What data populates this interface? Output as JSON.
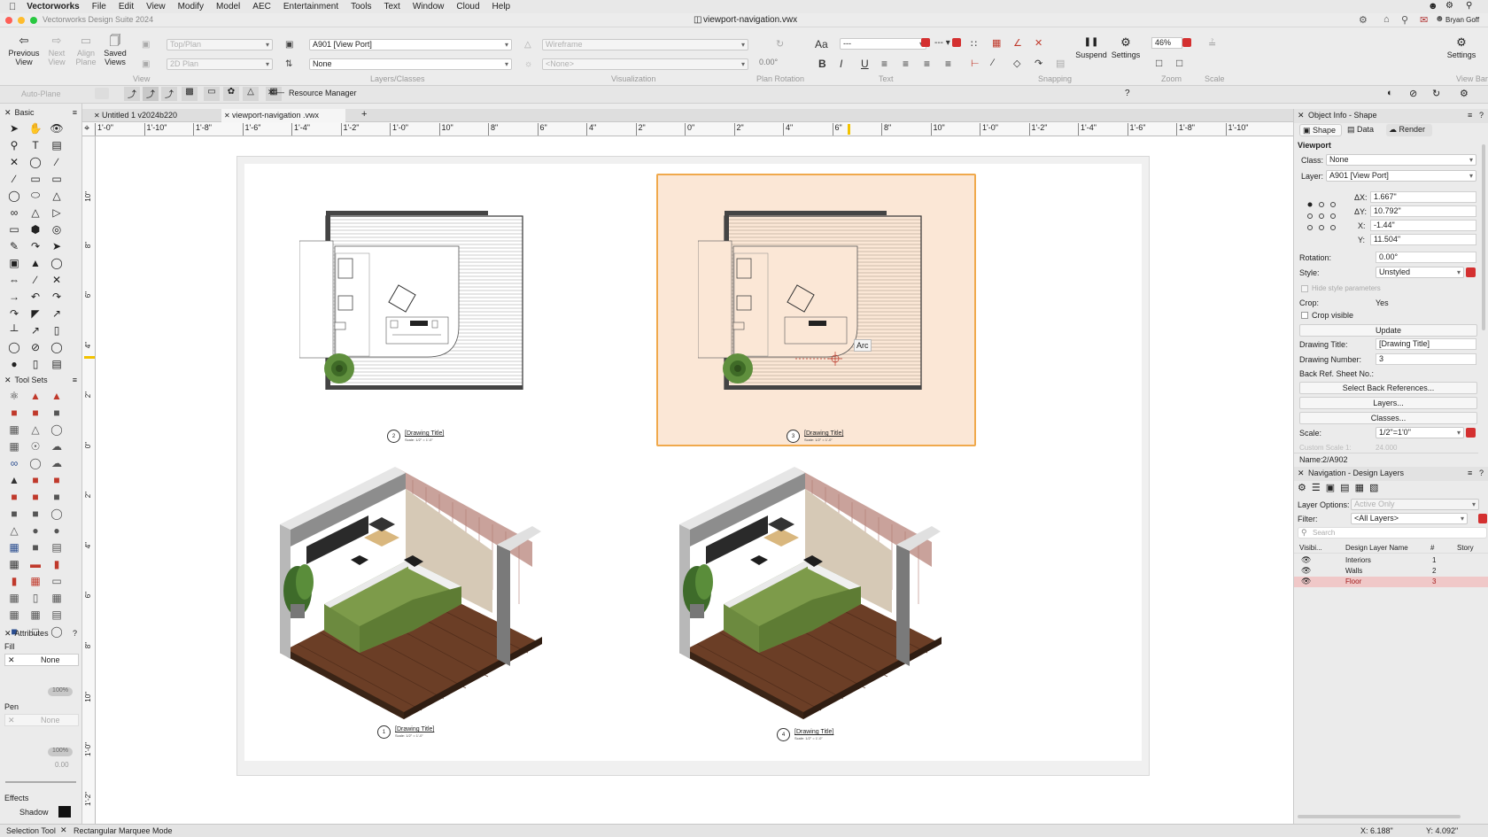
{
  "menubar": {
    "app_name": "Vectorworks",
    "items": [
      "File",
      "Edit",
      "View",
      "Modify",
      "Model",
      "AEC",
      "Entertainment",
      "Tools",
      "Text",
      "Window",
      "Cloud",
      "Help"
    ]
  },
  "window": {
    "app_title": "Vectorworks Design Suite 2024",
    "doc_title": "viewport-navigation.vwx",
    "user": "Bryan Goff"
  },
  "toolbar": {
    "previous_view": "Previous\nView",
    "next_view": "Next\nView",
    "align_plane": "Align\nPlane",
    "saved_views": "Saved\nViews",
    "view_select": "Top/Plan",
    "plane_select": "2D Plan",
    "layer_select": "A901 [View Port]",
    "class_select": "None",
    "render_select": "Wireframe",
    "vis_select": "<None>",
    "plan_rotation": "0.00°",
    "font_label": "Aa",
    "text_style": "---",
    "suspend": "Suspend",
    "settings": "Settings",
    "zoom": "46%",
    "right_settings": "Settings",
    "view_bar": "View Bar",
    "group_labels": {
      "view": "View",
      "layers": "Layers/Classes",
      "visualization": "Visualization",
      "plan_rotation": "Plan Rotation",
      "text": "Text",
      "snapping": "Snapping",
      "zoom": "Zoom",
      "scale": "Scale"
    }
  },
  "modebar": {
    "auto_plane": "Auto-Plane",
    "resource_manager": "Resource Manager"
  },
  "left_palettes": {
    "basic": "Basic",
    "tool_sets": "Tool Sets",
    "attributes": "Attributes",
    "fill_label": "Fill",
    "fill_value": "None",
    "pen_label": "Pen",
    "pen_value": "None",
    "opacity_a": "100%",
    "opacity_b": "100%",
    "thickness": "0.00",
    "effects": "Effects",
    "shadow": "Shadow"
  },
  "tabs": [
    {
      "label": "Untitled 1 v2024b220"
    },
    {
      "label": "viewport-navigation .vwx"
    }
  ],
  "ruler": {
    "h_marks": [
      "1'-0\"",
      "1'-10\"",
      "1'-8\"",
      "1'-6\"",
      "1'-4\"",
      "1'-2\"",
      "1'-0\"",
      "10\"",
      "8\"",
      "6\"",
      "4\"",
      "2\"",
      "0\"",
      "2\"",
      "4\"",
      "6\"",
      "8\"",
      "10\"",
      "1'-0\"",
      "1'-2\"",
      "1'-4\"",
      "1'-6\"",
      "1'-8\"",
      "1'-10\""
    ],
    "v_marks": [
      "10\"",
      "8\"",
      "6\"",
      "4\"",
      "2\"",
      "0\"",
      "2\"",
      "4\"",
      "6\"",
      "8\"",
      "10\"",
      "1'-0\"",
      "1'-2\""
    ]
  },
  "viewports": [
    {
      "title": "[Drawing Title]",
      "number": "2",
      "scale": "Scale: 1/2\" = 1'-0\""
    },
    {
      "title": "[Drawing Title]",
      "number": "3",
      "scale": "Scale: 1/2\" = 1'-0\""
    },
    {
      "title": "[Drawing Title]",
      "number": "1",
      "scale": "Scale: 1/2\" = 1'-0\""
    },
    {
      "title": "[Drawing Title]",
      "number": "4",
      "scale": "Scale: 1/2\" = 1'-0\""
    }
  ],
  "cursor_tooltip": "Arc",
  "object_info": {
    "header": "Object Info - Shape",
    "tabs": [
      "Shape",
      "Data",
      "Render"
    ],
    "object_type": "Viewport",
    "class_label": "Class:",
    "class_value": "None",
    "layer_label": "Layer:",
    "layer_value": "A901 [View Port]",
    "dx_label": "ΔX:",
    "dx": "1.667\"",
    "dy_label": "ΔY:",
    "dy": "10.792\"",
    "x_label": "X:",
    "x": "-1.44\"",
    "y_label": "Y:",
    "y": "11.504\"",
    "rotation_label": "Rotation:",
    "rotation": "0.00°",
    "style_label": "Style:",
    "style": "Unstyled",
    "hide_style": "Hide style parameters",
    "crop_label": "Crop:",
    "crop": "Yes",
    "crop_visible": "Crop visible",
    "update": "Update",
    "drawing_title_label": "Drawing Title:",
    "drawing_title": "[Drawing Title]",
    "drawing_number_label": "Drawing Number:",
    "drawing_number": "3",
    "back_ref_label": "Back Ref. Sheet No.:",
    "select_back_refs": "Select Back References...",
    "layers_btn": "Layers...",
    "classes_btn": "Classes...",
    "scale_label": "Scale:",
    "scale": "1/2\"=1'0\"",
    "custom_scale_label": "Custom Scale 1:",
    "custom_scale": "24.000",
    "name_label": "Name:",
    "name": "2/A902"
  },
  "navigation": {
    "header": "Navigation - Design Layers",
    "layer_options_label": "Layer Options:",
    "layer_options": "Active Only",
    "filter_label": "Filter:",
    "filter": "<All Layers>",
    "search_placeholder": "Search",
    "columns": [
      "Visibi...",
      "Design Layer Name",
      "#",
      "Story"
    ],
    "rows": [
      {
        "name": "Interiors",
        "num": "1"
      },
      {
        "name": "Walls",
        "num": "2"
      },
      {
        "name": "Floor",
        "num": "3"
      }
    ]
  },
  "status": {
    "tool": "Selection Tool",
    "mode": "Rectangular Marquee Mode",
    "x": "X: 6.188\"",
    "y": "Y: 4.092\""
  }
}
